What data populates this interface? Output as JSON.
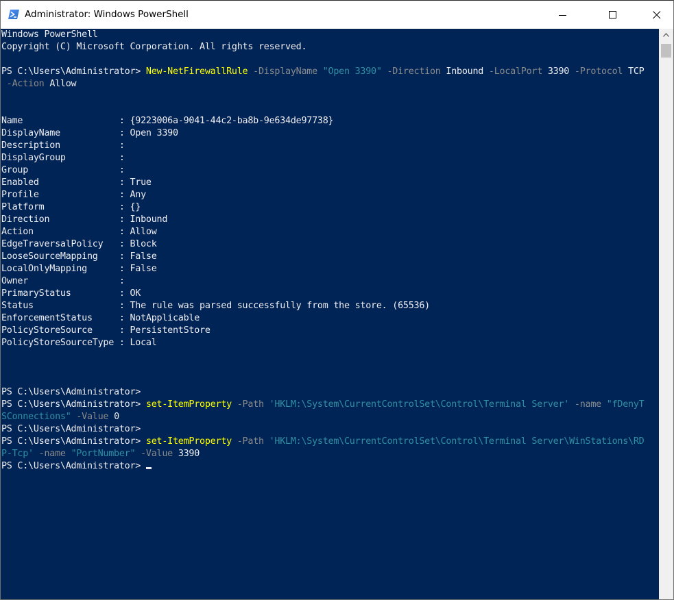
{
  "window": {
    "title": "Administrator: Windows PowerShell",
    "icon": "powershell-icon",
    "controls": {
      "minimize": "minimize-icon",
      "maximize": "maximize-icon",
      "close": "close-icon"
    }
  },
  "console": {
    "banner": {
      "line1": "Windows PowerShell",
      "line2": "Copyright (C) Microsoft Corporation. All rights reserved."
    },
    "cmd1": {
      "prompt": "PS C:\\Users\\Administrator> ",
      "cmdlet": "New-NetFirewallRule",
      "p1": " -DisplayName ",
      "v1": "\"Open 3390\"",
      "p2": " -Direction ",
      "v2": "Inbound",
      "p3": " -LocalPort ",
      "v3": "3390",
      "p4": " -Protocol ",
      "v4": "TCP",
      "wrap_p5": " -Action ",
      "wrap_v5": "Allow"
    },
    "output_rows": [
      {
        "key": "Name                  ",
        "sep": ": ",
        "value": "{9223006a-9041-44c2-ba8b-9e634de97738}"
      },
      {
        "key": "DisplayName           ",
        "sep": ": ",
        "value": "Open 3390"
      },
      {
        "key": "Description           ",
        "sep": ":",
        "value": ""
      },
      {
        "key": "DisplayGroup          ",
        "sep": ":",
        "value": ""
      },
      {
        "key": "Group                 ",
        "sep": ":",
        "value": ""
      },
      {
        "key": "Enabled               ",
        "sep": ": ",
        "value": "True"
      },
      {
        "key": "Profile               ",
        "sep": ": ",
        "value": "Any"
      },
      {
        "key": "Platform              ",
        "sep": ": ",
        "value": "{}"
      },
      {
        "key": "Direction             ",
        "sep": ": ",
        "value": "Inbound"
      },
      {
        "key": "Action                ",
        "sep": ": ",
        "value": "Allow"
      },
      {
        "key": "EdgeTraversalPolicy   ",
        "sep": ": ",
        "value": "Block"
      },
      {
        "key": "LooseSourceMapping    ",
        "sep": ": ",
        "value": "False"
      },
      {
        "key": "LocalOnlyMapping      ",
        "sep": ": ",
        "value": "False"
      },
      {
        "key": "Owner                 ",
        "sep": ":",
        "value": ""
      },
      {
        "key": "PrimaryStatus         ",
        "sep": ": ",
        "value": "OK"
      },
      {
        "key": "Status                ",
        "sep": ": ",
        "value": "The rule was parsed successfully from the store. (65536)"
      },
      {
        "key": "EnforcementStatus     ",
        "sep": ": ",
        "value": "NotApplicable"
      },
      {
        "key": "PolicyStoreSource     ",
        "sep": ": ",
        "value": "PersistentStore"
      },
      {
        "key": "PolicyStoreSourceType ",
        "sep": ": ",
        "value": "Local"
      }
    ],
    "prompt2": "PS C:\\Users\\Administrator>",
    "cmd2": {
      "prompt": "PS C:\\Users\\Administrator> ",
      "cmdlet": "set-ItemProperty",
      "p1": " -Path ",
      "v1": "'HKLM:\\System\\CurrentControlSet\\Control\\Terminal Server'",
      "p2": " -name ",
      "v2_part1": "\"fDenyT",
      "wrap_v2_part2": "SConnections\"",
      "wrap_p3": " -Value ",
      "wrap_v3": "0"
    },
    "prompt3": "PS C:\\Users\\Administrator>",
    "cmd3": {
      "prompt": "PS C:\\Users\\Administrator> ",
      "cmdlet": "set-ItemProperty",
      "p1": " -Path ",
      "v1_part1": "'HKLM:\\System\\CurrentControlSet\\Control\\Terminal Server\\WinStations\\RD",
      "wrap_v1_part2": "P-Tcp'",
      "wrap_p2": " -name ",
      "wrap_v2": "\"PortNumber\"",
      "wrap_p3": " -Value ",
      "wrap_v3": "3390"
    },
    "final_prompt": "PS C:\\Users\\Administrator> "
  },
  "colors": {
    "background": "#012456",
    "text": "#eeedf0",
    "cmdlet": "#ffff00",
    "parameter": "#8b8b8b",
    "string": "#2f8fa3"
  },
  "scrollbar": {
    "up_arrow": "chevron-up-icon"
  }
}
